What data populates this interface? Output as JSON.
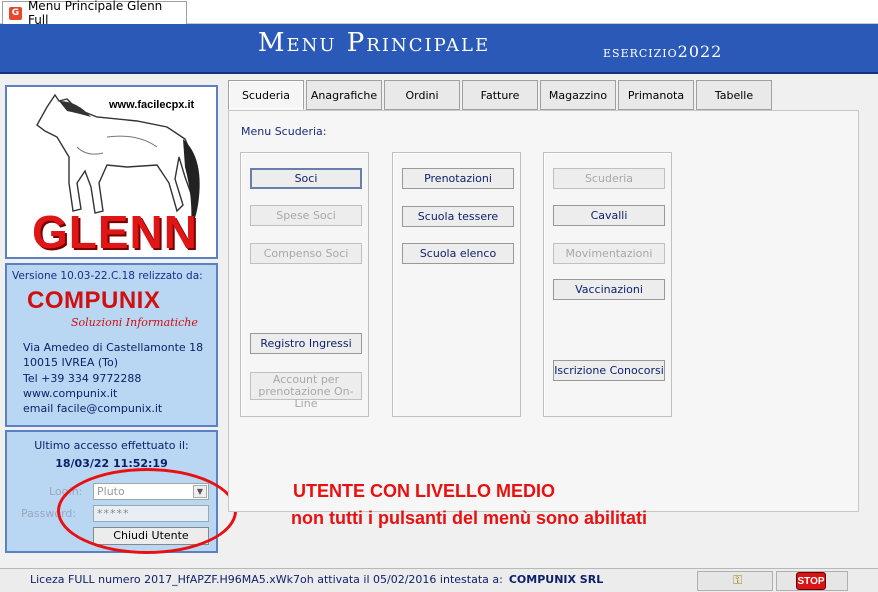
{
  "window": {
    "tab_title": "Menu Principale Glenn Full"
  },
  "header": {
    "title": "Menu Principale",
    "year": "esercizio2022"
  },
  "logo": {
    "url": "www.facilecpx.it",
    "brand": "GLENN"
  },
  "info": {
    "version": "Versione  10.03-22.C.18  relizzato da:",
    "company": "COMPUNIX",
    "company_sub": "Soluzioni Informatiche",
    "address_lines": [
      "Via Amedeo di Castellamonte 18",
      "10015   IVREA    (To)",
      "Tel +39 334 9772288",
      "www.compunix.it",
      "email facile@compunix.it"
    ]
  },
  "login": {
    "last_access_label": "Ultimo accesso effettuato il:",
    "last_access_time": "18/03/22 11:52:19",
    "login_label": "Login:",
    "login_value": "Pluto",
    "password_label": "Password:",
    "password_value": "*****",
    "logout_button": "Chiudi Utente"
  },
  "tabs": [
    {
      "label": "Scuderia",
      "active": true
    },
    {
      "label": "Anagrafiche",
      "active": false
    },
    {
      "label": "Ordini",
      "active": false
    },
    {
      "label": "Fatture",
      "active": false
    },
    {
      "label": "Magazzino",
      "active": false
    },
    {
      "label": "Primanota",
      "active": false
    },
    {
      "label": "Tabelle",
      "active": false
    }
  ],
  "main": {
    "menu_label": "Menu Scuderia:",
    "groups": [
      {
        "buttons": [
          {
            "label": "Soci",
            "enabled": true
          },
          {
            "label": "Spese Soci",
            "enabled": false
          },
          {
            "label": "Compenso Soci",
            "enabled": false
          },
          {
            "label": "Registro Ingressi",
            "enabled": true
          },
          {
            "label": "Account per prenotazione On-Line",
            "enabled": false
          }
        ]
      },
      {
        "buttons": [
          {
            "label": "Prenotazioni",
            "enabled": true
          },
          {
            "label": "Scuola tessere",
            "enabled": true
          },
          {
            "label": "Scuola  elenco",
            "enabled": true
          }
        ]
      },
      {
        "buttons": [
          {
            "label": "Scuderia",
            "enabled": false
          },
          {
            "label": "Cavalli",
            "enabled": true
          },
          {
            "label": "Movimentazioni",
            "enabled": false
          },
          {
            "label": "Vaccinazioni",
            "enabled": true
          },
          {
            "label": "Iscrizione Conocorsi",
            "enabled": true
          }
        ]
      }
    ]
  },
  "annotation": {
    "line1": "UTENTE CON LIVELLO MEDIO",
    "line2": "non tutti i pulsanti del menù sono abilitati",
    "color": "#e81010"
  },
  "status": {
    "license_text": "Liceza FULL numero 2017_HfAPZF.H96MA5.xWk7oh attivata il 05/02/2016 intestata a:",
    "company": "COMPUNIX SRL",
    "stop_label": "STOP"
  },
  "colors": {
    "header_bg": "#2b59b8",
    "panel_bg": "#b9d6f2",
    "brand_red": "#d01010"
  }
}
